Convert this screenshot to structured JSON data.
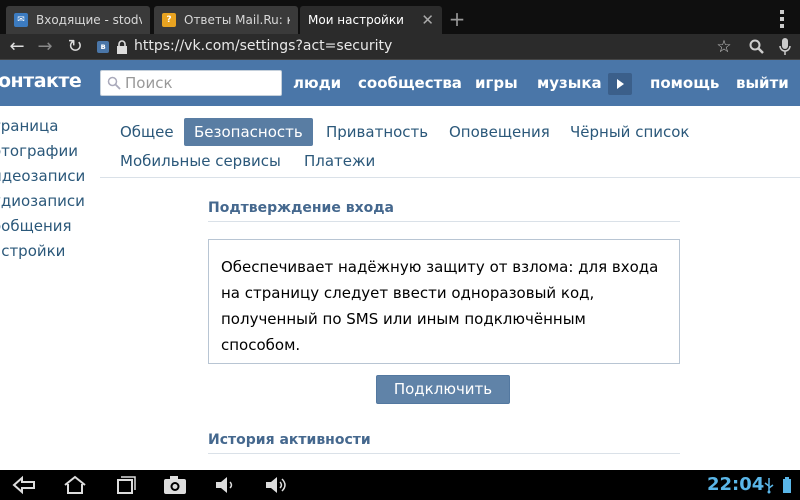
{
  "browser": {
    "tabs": [
      {
        "label": "Входящие - stodv",
        "favicon": "mail-favicon",
        "active": false
      },
      {
        "label": "Ответы Mail.Ru: к",
        "favicon": "answers-favicon",
        "active": false
      },
      {
        "label": "Мои настройки",
        "favicon": "",
        "active": true
      }
    ],
    "new_tab_symbol": "+",
    "url": "https://vk.com/settings?act=security",
    "url_favicon_text": "в"
  },
  "vk": {
    "logo": "онтакте",
    "search_placeholder": "Поиск",
    "nav": [
      "люди",
      "сообщества",
      "игры",
      "музыка",
      "помощь",
      "выйти"
    ],
    "left_menu": [
      "траница",
      "отографии",
      "идеозаписи",
      "удиозаписи",
      "ообщения",
      "астройки"
    ],
    "settings_tabs": [
      "Общее",
      "Безопасность",
      "Приватность",
      "Оповещения",
      "Чёрный список",
      "Мобильные сервисы",
      "Платежи"
    ],
    "active_tab": "Безопасность",
    "login_confirm": {
      "title": "Подтверждение входа",
      "description": "Обеспечивает надёжную защиту от взлома: для входа на страницу следует ввести одноразовый код, полученный по SMS или иным подключённым способом.",
      "button": "Подключить"
    },
    "activity_history_title": "История активности"
  },
  "system": {
    "clock": "22:04"
  },
  "colors": {
    "vk_blue": "#4a76a8",
    "active_tab": "#597da3",
    "link": "#2b587a",
    "clock": "#5ab6e8"
  }
}
